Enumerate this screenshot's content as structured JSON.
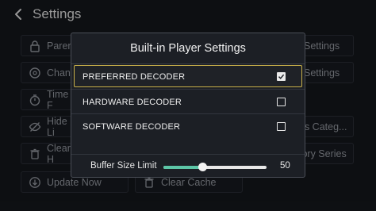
{
  "header": {
    "title": "Settings"
  },
  "background": {
    "left_items": [
      {
        "label": "Parente",
        "icon": "lock-icon"
      },
      {
        "label": "Chang",
        "icon": "gauge-icon"
      },
      {
        "label": "Time F",
        "icon": "stopwatch-icon"
      },
      {
        "label": "Hide Li",
        "icon": "eye-off-icon"
      },
      {
        "label": "Clear H",
        "icon": "trash-icon"
      },
      {
        "label": "Update Now",
        "icon": "download-icon"
      }
    ],
    "right_items": [
      {
        "label": "Settings"
      },
      {
        "label": "Settings"
      },
      {
        "label": "es Categ..."
      },
      {
        "label": "tory Series"
      }
    ],
    "clear_cache": {
      "label": "Clear Cache",
      "icon": "trash-icon"
    }
  },
  "dialog": {
    "title": "Built-in Player Settings",
    "options": [
      {
        "label": "PREFERRED DECODER",
        "checked": true
      },
      {
        "label": "HARDWARE DECODER",
        "checked": false
      },
      {
        "label": "SOFTWARE DECODER",
        "checked": false
      }
    ],
    "buffer": {
      "label": "Buffer Size Limit",
      "value": "50",
      "fraction": 0.375
    }
  },
  "colors": {
    "accent": "#5cc5a6",
    "focus": "#c9b14a"
  }
}
